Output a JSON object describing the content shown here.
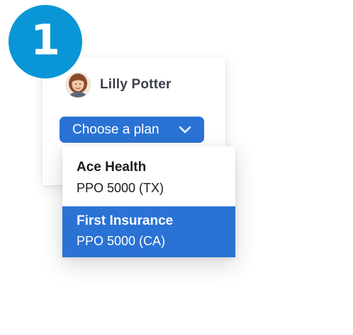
{
  "step": {
    "number": "1"
  },
  "user": {
    "name": "Lilly Potter",
    "avatar_icon": "user-avatar-photo"
  },
  "plan_select": {
    "label": "Choose a plan",
    "icon": "chevron-down-icon"
  },
  "menu": {
    "options": [
      {
        "name": "Ace Health",
        "plan": "PPO 5000 (TX)",
        "selected": false
      },
      {
        "name": "First Insurance",
        "plan": "PPO 5000 (CA)",
        "selected": true
      }
    ]
  },
  "colors": {
    "badge": "#0a96d6",
    "accent": "#2a72d4",
    "name_text": "#3b3f4a"
  }
}
